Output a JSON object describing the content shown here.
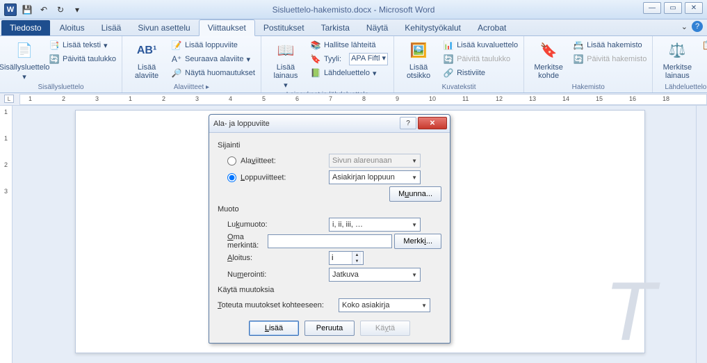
{
  "app": {
    "title": "Sisluettelo-hakemisto.docx - Microsoft Word",
    "logo": "W"
  },
  "qat": {
    "save": "💾",
    "undo": "↶",
    "redo": "↷",
    "refresh": "↻"
  },
  "wc": {
    "min": "—",
    "max": "▭",
    "close": "✕"
  },
  "tabs": {
    "file": "Tiedosto",
    "items": [
      "Aloitus",
      "Lisää",
      "Sivun asettelu",
      "Viittaukset",
      "Postitukset",
      "Tarkista",
      "Näytä",
      "Kehitystyökalut",
      "Acrobat"
    ],
    "activeIndex": 3,
    "min": "⌄"
  },
  "ribbon": {
    "g1": {
      "label": "Sisällysluettelo",
      "toc": "Sisällysluettelo",
      "addText": "Lisää teksti",
      "updateTable": "Päivitä taulukko"
    },
    "g2": {
      "label": "Alaviitteet",
      "insertFootnote": "Lisää\nalaviite",
      "ab1": "AB¹",
      "insertEndnote": "Lisää loppuviite",
      "nextFootnote": "Seuraava alaviite",
      "showNotes": "Näytä huomautukset"
    },
    "g3": {
      "label": "Lainaukset ja lähdeluettelo",
      "insertCitation": "Lisää\nlainaus",
      "manageSources": "Hallitse lähteitä",
      "styleLabel": "Tyyli:",
      "styleValue": "APA Fiftl",
      "bibliography": "Lähdeluettelo"
    },
    "g4": {
      "label": "Kuvatekstit",
      "insertCaption": "Lisää\notsikko",
      "insertTableFigures": "Lisää kuvaluettelo",
      "updateTable": "Päivitä taulukko",
      "crossRef": "Ristiviite"
    },
    "g5": {
      "label": "Hakemisto",
      "markEntry": "Merkitse\nkohde",
      "insertIndex": "Lisää hakemisto",
      "updateIndex": "Päivitä hakemisto"
    },
    "g6": {
      "label": "Lähdeluettelo",
      "markCitation": "Merkitse\nlainaus"
    }
  },
  "ruler": {
    "marks": [
      "1",
      "2",
      "3",
      "1",
      "2",
      "3",
      "4",
      "5",
      "6",
      "7",
      "8",
      "9",
      "10",
      "11",
      "12",
      "13",
      "14",
      "15",
      "16",
      "18"
    ],
    "vmarks": [
      "1",
      "1",
      "2",
      "3"
    ]
  },
  "dialog": {
    "title": "Ala- ja loppuviite",
    "help": "?",
    "close": "✕",
    "sijainti": "Sijainti",
    "optFootnotes": "Alaviitteet:",
    "optEndnotes": "Loppuviitteet:",
    "footPos": "Sivun alareunaan",
    "endPos": "Asiakirjan loppuun",
    "convert": "Muunna...",
    "muoto": "Muoto",
    "numFormatLabel": "Lukumuoto:",
    "numFormatValue": "i, ii, iii, …",
    "customMarkLabel": "Oma merkintä:",
    "symbolBtn": "Merkki...",
    "startAtLabel": "Aloitus:",
    "startAtValue": "i",
    "numberingLabel": "Numerointi:",
    "numberingValue": "Jatkuva",
    "apply": "Käytä muutoksia",
    "applyToLabel": "Toteuta muutokset kohteeseen:",
    "applyToValue": "Koko asiakirja",
    "btnInsert": "Lisää",
    "btnCancel": "Peruuta",
    "btnApply": "Käytä"
  }
}
